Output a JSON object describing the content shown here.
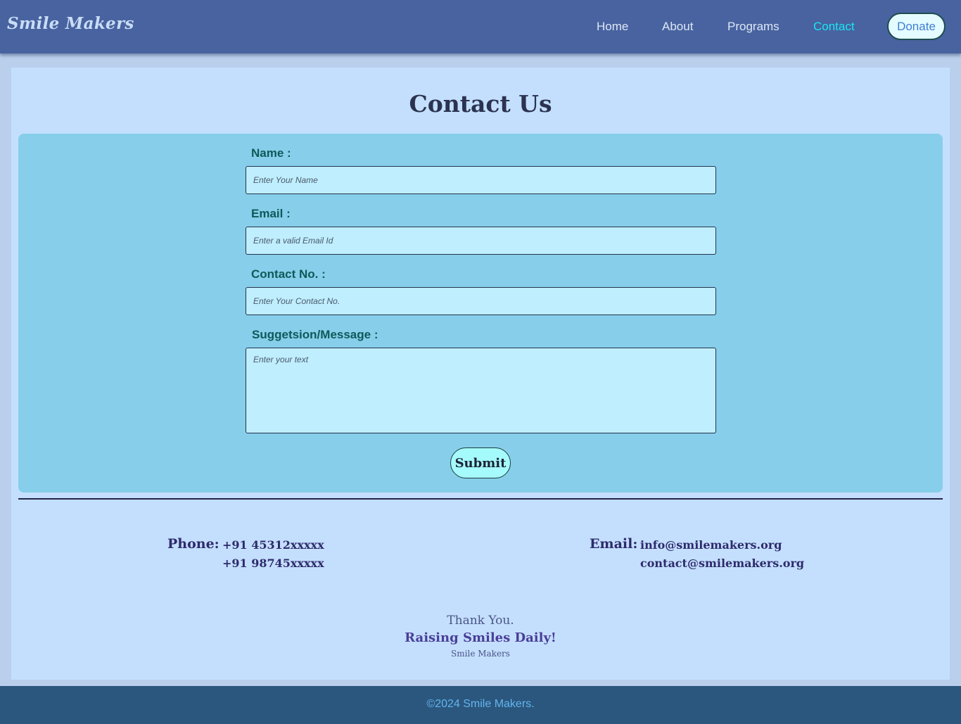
{
  "brand": {
    "logo_text": "Smile Makers"
  },
  "nav": {
    "links": [
      {
        "label": "Home",
        "active": false
      },
      {
        "label": "About",
        "active": false
      },
      {
        "label": "Programs",
        "active": false
      },
      {
        "label": "Contact",
        "active": true
      }
    ],
    "donate_label": "Donate"
  },
  "page": {
    "title": "Contact Us"
  },
  "form": {
    "name": {
      "label": "Name :",
      "placeholder": "Enter Your Name",
      "value": ""
    },
    "email": {
      "label": "Email :",
      "placeholder": "Enter a valid Email Id",
      "value": ""
    },
    "contact_no": {
      "label": "Contact No. :",
      "placeholder": "Enter Your Contact No.",
      "value": ""
    },
    "message": {
      "label": "Suggetsion/Message :",
      "placeholder": "Enter your text",
      "value": ""
    },
    "submit_label": "Submit"
  },
  "contact_info": {
    "phone_label": "Phone:",
    "phones": [
      "+91 45312xxxxx",
      "+91 98745xxxxx"
    ],
    "email_label": "Email:",
    "emails": [
      "info@smilemakers.org",
      "contact@smilemakers.org"
    ]
  },
  "closing": {
    "thanks": "Thank You.",
    "tagline": "Raising Smiles Daily!",
    "signature": "Smile Makers"
  },
  "footer": {
    "copyright": "©2024 Smile Makers."
  },
  "colors": {
    "navbar_bg": "#4863a0",
    "active_link": "#19e6f2",
    "form_panel_bg": "#87ceea",
    "input_bg": "#bfeefe",
    "footer_bg": "#2b577e"
  }
}
